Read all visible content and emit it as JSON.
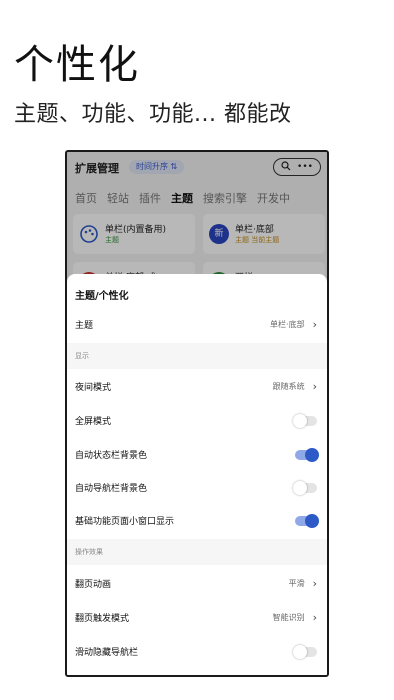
{
  "promo": {
    "title": "个性化",
    "subtitle": "主题、功能、功能... 都能改"
  },
  "app": {
    "header_title": "扩展管理",
    "header_badge": "时间升序 ⇅",
    "pill_icons": [
      "search-icon",
      "more-icon"
    ],
    "tabs": [
      {
        "label": "首页",
        "active": false
      },
      {
        "label": "轻站",
        "active": false
      },
      {
        "label": "插件",
        "active": false
      },
      {
        "label": "主题",
        "active": true
      },
      {
        "label": "搜索引擎",
        "active": false
      },
      {
        "label": "开发中",
        "active": false
      }
    ],
    "cards": [
      {
        "title": "单栏(内置备用)",
        "subtitle": "主题",
        "sub_color": "#2e8b3a",
        "icon": "palette-icon"
      },
      {
        "title": "单栏·底部",
        "subtitle": "主题 当前主题",
        "sub_color": "#c08a1b",
        "icon": "new-badge-icon",
        "icon_text": "新"
      },
      {
        "title": "单栏·底部·式",
        "subtitle": "",
        "icon": "red-circle-icon"
      },
      {
        "title": "双栏",
        "subtitle": "",
        "icon": "green-circle-icon"
      }
    ]
  },
  "sheet": {
    "title": "主题/个性化",
    "theme_row": {
      "label": "主题",
      "value": "单栏·底部"
    },
    "section_display": "显示",
    "night_row": {
      "label": "夜间模式",
      "value": "跟随系统"
    },
    "fullscreen_row": {
      "label": "全屏模式",
      "toggle": false
    },
    "statusbar_row": {
      "label": "自动状态栏背景色",
      "toggle": true
    },
    "navbar_row": {
      "label": "自动导航栏背景色",
      "toggle": false
    },
    "miniwindow_row": {
      "label": "基础功能页面小窗口显示",
      "toggle": true
    },
    "section_effects": "操作效果",
    "pageanim_row": {
      "label": "翻页动画",
      "value": "平滑"
    },
    "pagetrigger_row": {
      "label": "翻页触发模式",
      "value": "智能识别"
    },
    "hidenav_row": {
      "label": "滑动隐藏导航栏",
      "toggle": false
    }
  },
  "colors": {
    "accent": "#2e5ac8",
    "accent_light": "#8fa8e8"
  }
}
